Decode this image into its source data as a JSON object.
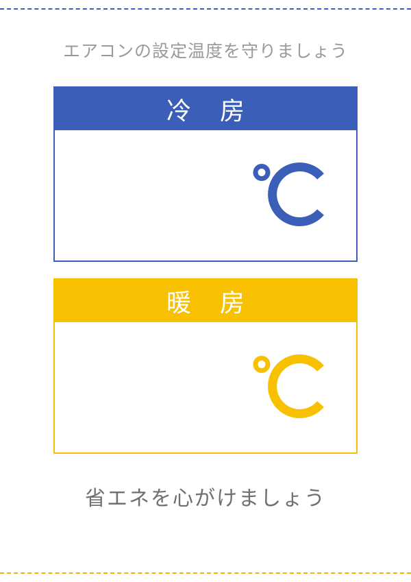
{
  "heading": "エアコンの設定温度を守りましょう",
  "cards": {
    "cool": {
      "label": "冷 房"
    },
    "warm": {
      "label": "暖 房"
    }
  },
  "footer": "省エネを心がけましょう",
  "colors": {
    "cool": "#3b5fb8",
    "warm": "#f7c000"
  }
}
